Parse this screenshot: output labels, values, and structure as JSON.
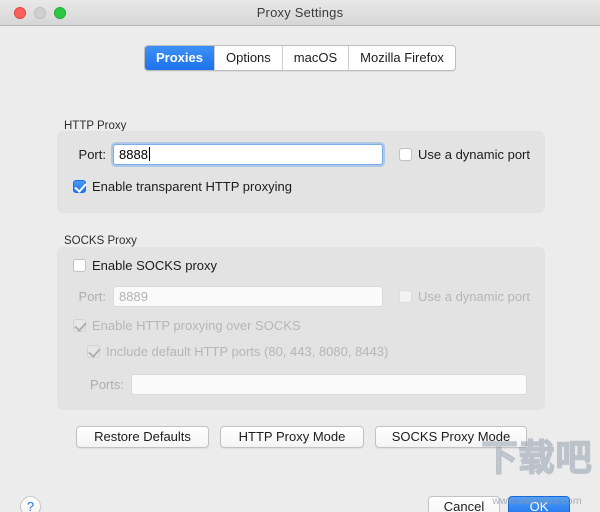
{
  "window": {
    "title": "Proxy Settings",
    "traffic_lights": {
      "close": "close-button",
      "minimize": "minimize-button",
      "zoom": "zoom-button"
    }
  },
  "tabs": [
    {
      "label": "Proxies",
      "active": true
    },
    {
      "label": "Options",
      "active": false
    },
    {
      "label": "macOS",
      "active": false
    },
    {
      "label": "Mozilla Firefox",
      "active": false
    }
  ],
  "http_proxy": {
    "group_title": "HTTP Proxy",
    "port_label": "Port:",
    "port_value": "8888",
    "dynamic_port_label": "Use a dynamic port",
    "dynamic_port_checked": false,
    "transparent_label": "Enable transparent HTTP proxying",
    "transparent_checked": true
  },
  "socks_proxy": {
    "group_title": "SOCKS Proxy",
    "enable_label": "Enable SOCKS proxy",
    "enable_checked": false,
    "port_label": "Port:",
    "port_placeholder": "8889",
    "port_value": "",
    "dynamic_port_label": "Use a dynamic port",
    "dynamic_port_checked": false,
    "http_over_socks_label": "Enable HTTP proxying over SOCKS",
    "http_over_socks_checked": true,
    "default_ports_label": "Include default HTTP ports (80, 443, 8080, 8443)",
    "default_ports_checked": true,
    "ports_label": "Ports:",
    "ports_value": "",
    "ports_placeholder": ""
  },
  "mode_buttons": [
    {
      "label": "Restore Defaults"
    },
    {
      "label": "HTTP Proxy Mode"
    },
    {
      "label": "SOCKS Proxy Mode"
    }
  ],
  "footer": {
    "help_label": "?",
    "cancel_label": "Cancel",
    "ok_label": "OK"
  },
  "watermark": {
    "text_cn": "下载吧",
    "url": "www.xiazaiba.com"
  },
  "colors": {
    "accent_blue": "#1d72ec",
    "window_bg": "#ececec",
    "group_bg": "#e3e3e3",
    "close_red": "#fc6058",
    "zoom_green": "#2bc840",
    "minimize_gray": "#cfcfcf"
  }
}
